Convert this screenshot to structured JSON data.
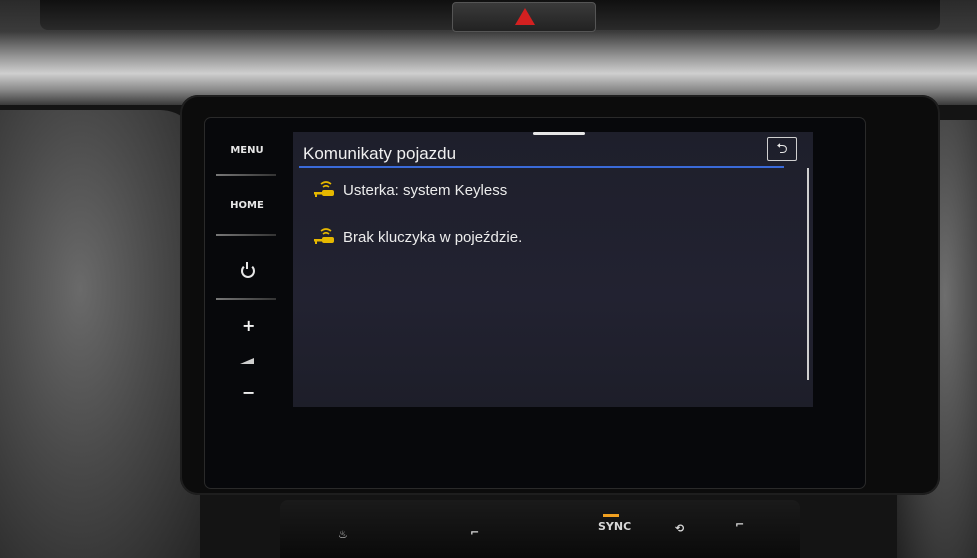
{
  "side_buttons": {
    "menu": "MENU",
    "home": "HOME"
  },
  "screen": {
    "title": "Komunikaty pojazdu",
    "messages": [
      {
        "text": "Usterka: system Keyless",
        "icon": "key-warning-icon"
      },
      {
        "text": "Brak kluczyka w pojeździe.",
        "icon": "key-warning-icon"
      }
    ]
  },
  "climate_panel": {
    "sync_label": "SYNC"
  },
  "colors": {
    "accent_line": "#3a6ad8",
    "icon_yellow": "#e6b800",
    "hazard_red": "#d42020"
  }
}
